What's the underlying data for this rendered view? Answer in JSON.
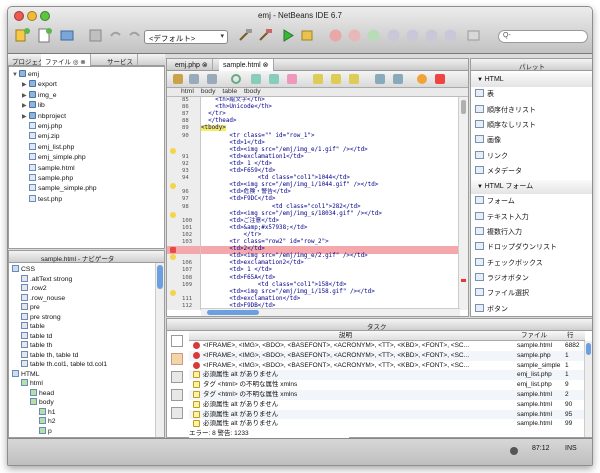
{
  "window": {
    "title": "emj - NetBeans IDE 6.7"
  },
  "toolbar": {
    "config_value": "<デフォルト>",
    "search_placeholder": "Q-"
  },
  "projects": {
    "tabs": [
      "プロジェクト",
      "ファイル ◎ ⊗",
      "サービス"
    ],
    "items": [
      {
        "label": "emj",
        "indent": 0,
        "type": "folder",
        "open": true
      },
      {
        "label": "export",
        "indent": 1,
        "type": "folder",
        "open": false
      },
      {
        "label": "img_e",
        "indent": 1,
        "type": "folder",
        "open": false
      },
      {
        "label": "lib",
        "indent": 1,
        "type": "folder",
        "open": false
      },
      {
        "label": "nbproject",
        "indent": 1,
        "type": "folder",
        "open": false
      },
      {
        "label": "emj.php",
        "indent": 1,
        "type": "file"
      },
      {
        "label": "emj.zip",
        "indent": 1,
        "type": "file"
      },
      {
        "label": "emj_list.php",
        "indent": 1,
        "type": "file"
      },
      {
        "label": "emj_simple.php",
        "indent": 1,
        "type": "file"
      },
      {
        "label": "sample.html",
        "indent": 1,
        "type": "file"
      },
      {
        "label": "sample.php",
        "indent": 1,
        "type": "file"
      },
      {
        "label": "sample_simple.php",
        "indent": 1,
        "type": "file"
      },
      {
        "label": "test.php",
        "indent": 1,
        "type": "file"
      }
    ]
  },
  "navigator": {
    "title": "sample.html - ナビゲータ",
    "items": [
      {
        "label": "CSS",
        "indent": 0
      },
      {
        "label": ".altText strong",
        "indent": 1
      },
      {
        "label": ".row2",
        "indent": 1
      },
      {
        "label": ".row_nouse",
        "indent": 1
      },
      {
        "label": "pre",
        "indent": 1
      },
      {
        "label": "pre strong",
        "indent": 1
      },
      {
        "label": "table",
        "indent": 1
      },
      {
        "label": "table td",
        "indent": 1
      },
      {
        "label": "table th",
        "indent": 1
      },
      {
        "label": "table th, table td",
        "indent": 1
      },
      {
        "label": "table th.col1, table td.col1",
        "indent": 1
      },
      {
        "label": "HTML",
        "indent": 0
      },
      {
        "label": "html",
        "indent": 1
      },
      {
        "label": "head",
        "indent": 2
      },
      {
        "label": "body",
        "indent": 2
      },
      {
        "label": "h1",
        "indent": 3
      },
      {
        "label": "h2",
        "indent": 3
      },
      {
        "label": "p",
        "indent": 3
      }
    ]
  },
  "editor": {
    "tabs": [
      "emj.php ⊗",
      "sample.html ⊗"
    ],
    "breadcrumb": "html body table tbody",
    "lines": [
      {
        "n": "85",
        "t": "    <th>絵文字</th>",
        "hl": "",
        "m": ""
      },
      {
        "n": "86",
        "t": "    <th>Unicode</th>",
        "hl": "",
        "m": ""
      },
      {
        "n": "87",
        "t": "  </tr>",
        "hl": "",
        "m": ""
      },
      {
        "n": "88",
        "t": "  </thead>",
        "hl": "",
        "m": ""
      },
      {
        "n": "89",
        "t": "<tbody>",
        "hl": "yellow",
        "m": ""
      },
      {
        "n": "90",
        "t": "        <tr class=\"\" id=\"row_1\">",
        "hl": "",
        "m": ""
      },
      {
        "n": "",
        "t": "        <td>1</td>",
        "hl": "",
        "m": ""
      },
      {
        "n": "",
        "t": "        <td><img src=\"/emj/img_e/1.gif\" /></td>",
        "hl": "",
        "m": "bulb"
      },
      {
        "n": "91",
        "t": "        <td>exclamation1</td>",
        "hl": "",
        "m": ""
      },
      {
        "n": "92",
        "t": "        <td> 1 </td>",
        "hl": "",
        "m": ""
      },
      {
        "n": "93",
        "t": "        <td>F659</td>",
        "hl": "",
        "m": ""
      },
      {
        "n": "94",
        "t": "                <td class=\"col1\">1044</td>",
        "hl": "",
        "m": ""
      },
      {
        "n": "",
        "t": "        <td><img src=\"/emj/img_i/1044.gif\" /></td>",
        "hl": "",
        "m": "bulb"
      },
      {
        "n": "96",
        "t": "        <td>危険・警告</td>",
        "hl": "",
        "m": ""
      },
      {
        "n": "97",
        "t": "        <td>F9DC</td>",
        "hl": "",
        "m": ""
      },
      {
        "n": "98",
        "t": "                    <td class=\"col1\">282</td>",
        "hl": "",
        "m": ""
      },
      {
        "n": "",
        "t": "        <td><img src=\"/emj/img_s/18034.gif\" /></td>",
        "hl": "",
        "m": "bulb"
      },
      {
        "n": "100",
        "t": "        <td>ご注意</td>",
        "hl": "",
        "m": ""
      },
      {
        "n": "101",
        "t": "        <td>&amp;#x57938;</td>",
        "hl": "",
        "m": ""
      },
      {
        "n": "102",
        "t": "            </tr>",
        "hl": "",
        "m": ""
      },
      {
        "n": "103",
        "t": "        <tr class=\"row2\" id=\"row_2\">",
        "hl": "",
        "m": ""
      },
      {
        "n": "",
        "t": "        <td>2</td>",
        "hl": "pink",
        "m": "err"
      },
      {
        "n": "",
        "t": "        <td><img src=\"/emj/img_e/2.gif\" /></td>",
        "hl": "",
        "m": "bulb"
      },
      {
        "n": "106",
        "t": "        <td>exclamation2</td>",
        "hl": "",
        "m": ""
      },
      {
        "n": "107",
        "t": "        <td> 1 </td>",
        "hl": "",
        "m": ""
      },
      {
        "n": "108",
        "t": "        <td>F65A</td>",
        "hl": "",
        "m": ""
      },
      {
        "n": "109",
        "t": "                <td class=\"col1\">158</td>",
        "hl": "",
        "m": ""
      },
      {
        "n": "",
        "t": "        <td><img src=\"/emj/img_i/158.gif\" /></td>",
        "hl": "",
        "m": "bulb"
      },
      {
        "n": "111",
        "t": "        <td>exclamation</td>",
        "hl": "",
        "m": ""
      },
      {
        "n": "112",
        "t": "        <td>F9DB</td>",
        "hl": "",
        "m": ""
      }
    ]
  },
  "palette": {
    "title": "パレット",
    "items": [
      {
        "label": "HTML",
        "group": true
      },
      {
        "label": "表",
        "group": false
      },
      {
        "label": "順序付きリスト",
        "group": false
      },
      {
        "label": "順序なしリスト",
        "group": false
      },
      {
        "label": "画像",
        "group": false
      },
      {
        "label": "リンク",
        "group": false
      },
      {
        "label": "メタデータ",
        "group": false
      },
      {
        "label": "HTML フォーム",
        "group": true
      },
      {
        "label": "フォーム",
        "group": false
      },
      {
        "label": "テキスト入力",
        "group": false
      },
      {
        "label": "複数行入力",
        "group": false
      },
      {
        "label": "ドロップダウンリスト",
        "group": false
      },
      {
        "label": "チェックボックス",
        "group": false
      },
      {
        "label": "ラジオボタン",
        "group": false
      },
      {
        "label": "ファイル選択",
        "group": false
      },
      {
        "label": "ボタン",
        "group": false
      }
    ]
  },
  "tasks": {
    "title": "タスク",
    "col_desc": "説明",
    "col_file": "ファイル",
    "col_line": "行",
    "rows": [
      {
        "kind": "err",
        "desc": "<IFRAME>, <IMG>, <BDO>, <BASEFONT>, <ACRONYM>, <TT>, <KBD>, <FONT>, <SC...",
        "file": "sample.html",
        "line": "6882"
      },
      {
        "kind": "err",
        "desc": "<IFRAME>, <IMG>, <BDO>, <BASEFONT>, <ACRONYM>, <TT>, <KBD>, <FONT>, <SC...",
        "file": "sample.php",
        "line": "1"
      },
      {
        "kind": "err",
        "desc": "<IFRAME>, <IMG>, <BDO>, <BASEFONT>, <ACRONYM>, <TT>, <KBD>, <FONT>, <SC...",
        "file": "sample_simple.p...",
        "line": "1"
      },
      {
        "kind": "warn",
        "desc": "必須属性 alt がありません",
        "file": "emj_list.php",
        "line": "1"
      },
      {
        "kind": "warn",
        "desc": "タグ <html> の不明な属性 xmlns",
        "file": "emj_list.php",
        "line": "9"
      },
      {
        "kind": "warn",
        "desc": "タグ <html> の不明な属性 xmlns",
        "file": "sample.html",
        "line": "2"
      },
      {
        "kind": "warn",
        "desc": "必須属性 alt がありません",
        "file": "sample.html",
        "line": "90"
      },
      {
        "kind": "warn",
        "desc": "必須属性 alt がありません",
        "file": "sample.html",
        "line": "95"
      },
      {
        "kind": "warn",
        "desc": "必須属性 alt がありません",
        "file": "sample.html",
        "line": "99"
      }
    ],
    "summary": "エラー: 8  警告: 1233"
  },
  "status": {
    "position": "87:12",
    "mode": "INS"
  }
}
